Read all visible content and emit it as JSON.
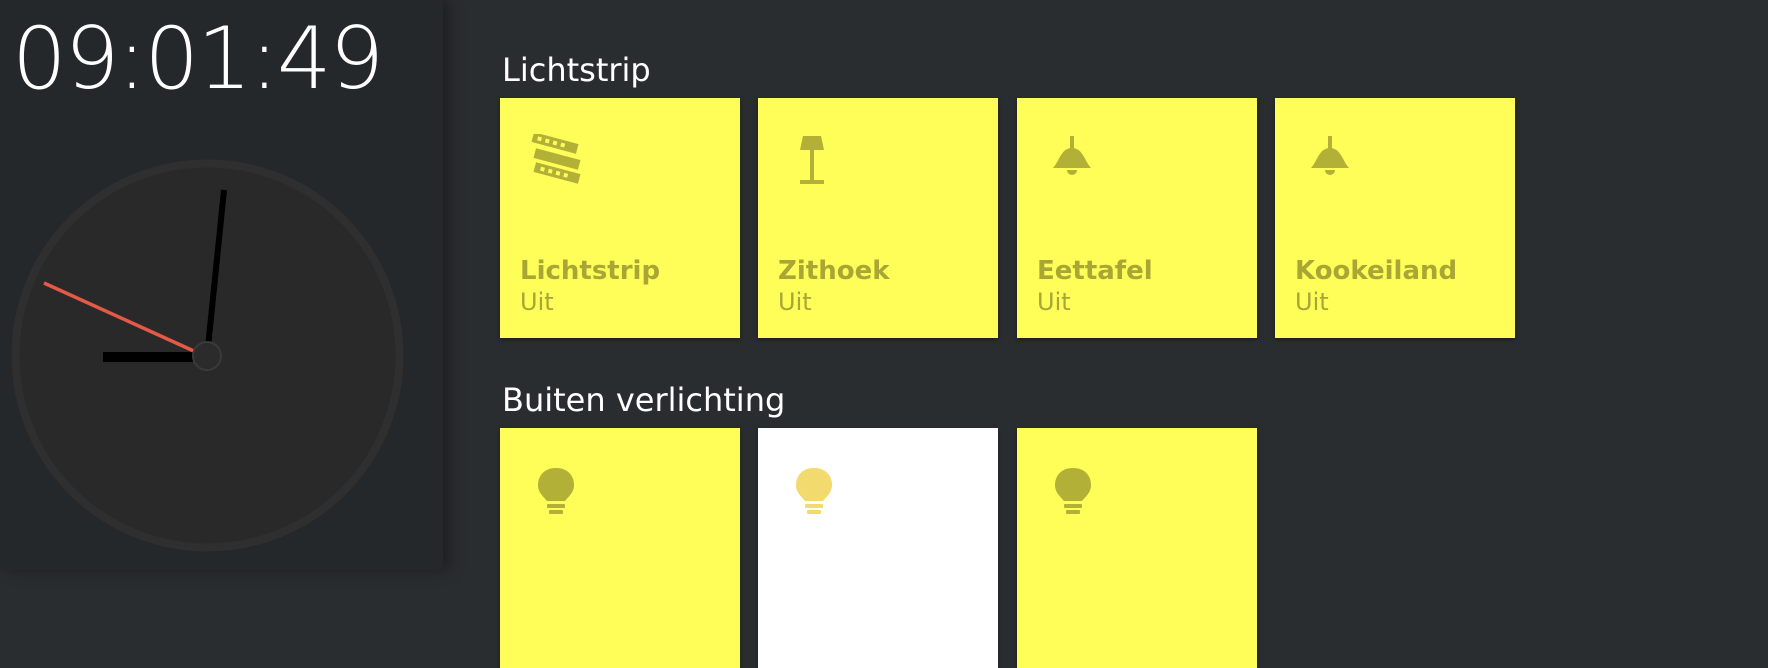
{
  "clock": {
    "time": "09:01:49"
  },
  "groups": [
    {
      "title": "Lichtstrip",
      "tiles": [
        {
          "name": "Lichtstrip",
          "state": "Uit",
          "icon": "film-strip-icon"
        },
        {
          "name": "Zithoek",
          "state": "Uit",
          "icon": "floor-lamp-icon"
        },
        {
          "name": "Eettafel",
          "state": "Uit",
          "icon": "ceiling-lamp-icon"
        },
        {
          "name": "Kookeiland",
          "state": "Uit",
          "icon": "ceiling-lamp-icon"
        }
      ]
    },
    {
      "title": "Buiten verlichting",
      "tiles": [
        {
          "name": "",
          "state": "",
          "icon": "lightbulb-icon"
        },
        {
          "name": "",
          "state": "",
          "icon": "lightbulb-icon"
        },
        {
          "name": "",
          "state": "",
          "icon": "lightbulb-icon"
        }
      ]
    }
  ],
  "colors": {
    "tile_on": "#fffd57",
    "tile_white": "#ffffff",
    "icon": "#b2b037",
    "bulb_light": "#f2da6e",
    "clock_second_hand": "#e55a47"
  }
}
